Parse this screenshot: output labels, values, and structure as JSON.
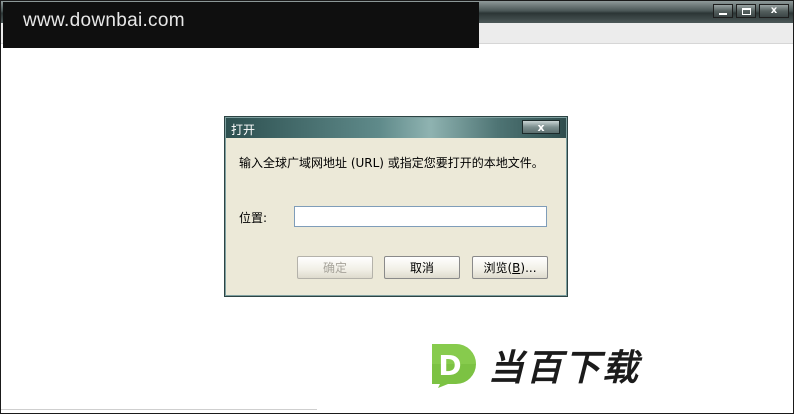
{
  "watermark": {
    "text": "www.downbai.com"
  },
  "main_window": {
    "controls": {
      "close_glyph": "x"
    }
  },
  "dialog": {
    "title": "打开",
    "close_glyph": "x",
    "prompt": "输入全球广域网地址 (URL) 或指定您要打开的本地文件。",
    "location_label": "位置:",
    "location_value": "",
    "buttons": {
      "ok": "确定",
      "cancel": "取消",
      "browse_prefix": "浏览(",
      "browse_accel": "B",
      "browse_suffix": ")..."
    }
  },
  "brand": {
    "badge_letter": "D",
    "text": "当百下载",
    "colors": {
      "badge_green": "#7cc243",
      "badge_dark": "#5a9a2c"
    }
  }
}
